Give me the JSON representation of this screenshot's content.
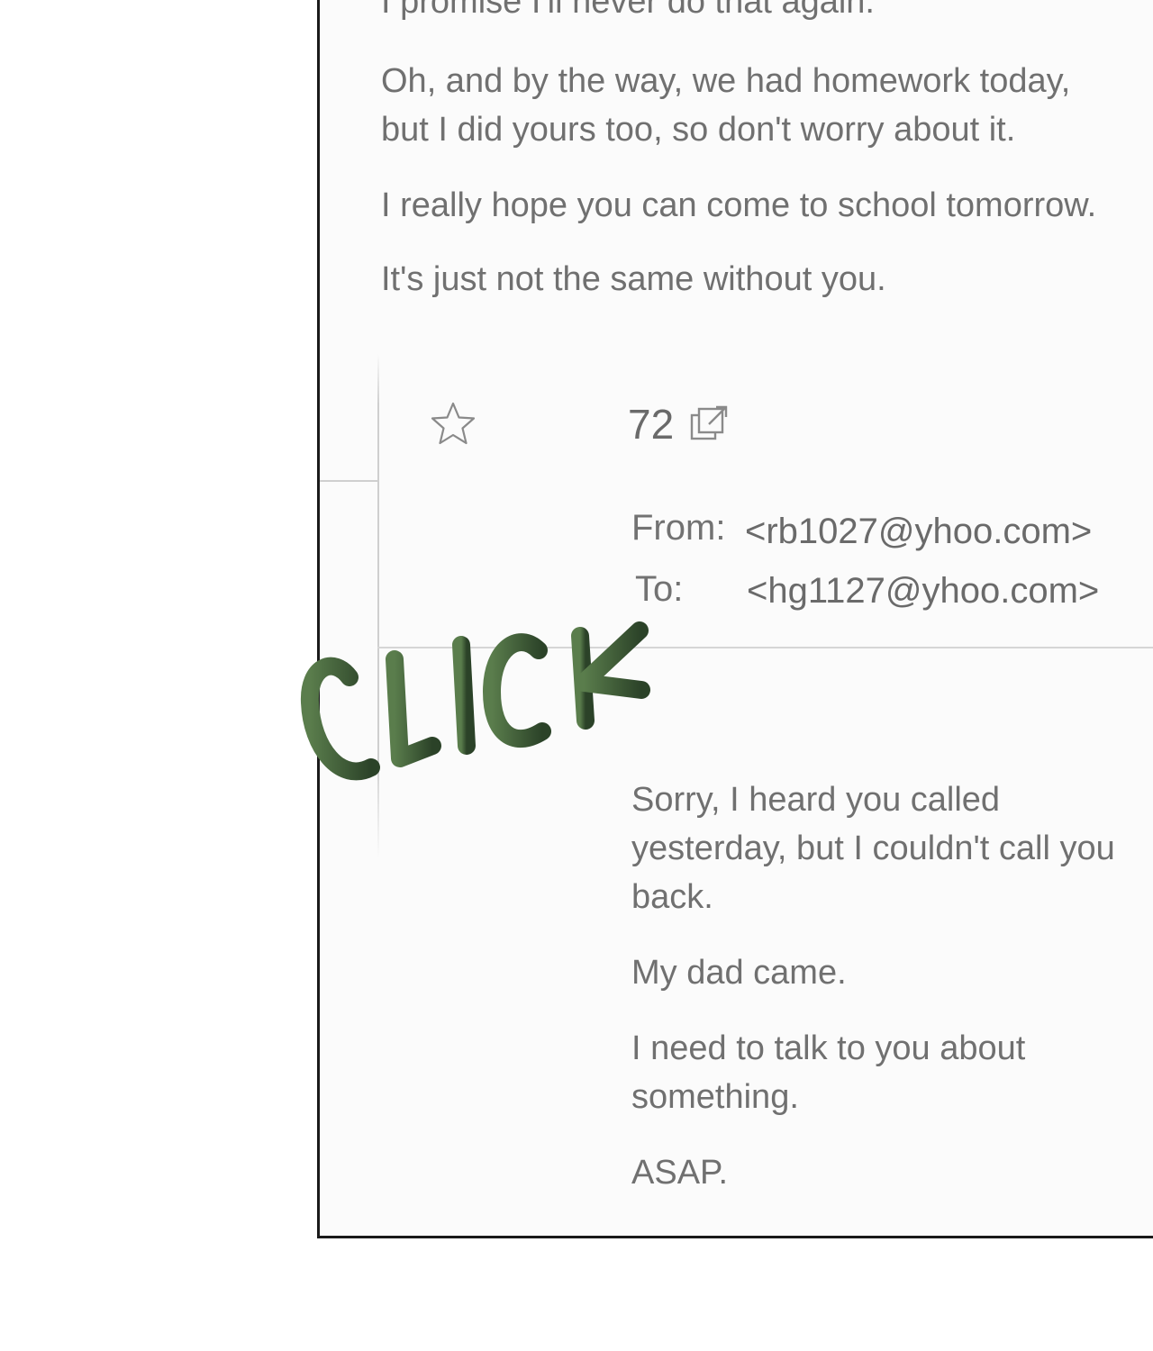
{
  "email_body": {
    "cut_line": "I promise I'll never do that again.",
    "paragraph_1": "Oh, and by the way, we had homework today, but I did yours too, so don't worry about it.",
    "paragraph_2": "I really hope you can come to school tomorrow.",
    "paragraph_3": "It's just not the same without you."
  },
  "message_header": {
    "star_icon": "star-outline-icon",
    "count": "72",
    "share_icon": "external-link-icon",
    "from_label": "From:",
    "from_value": "<rb1027@yhoo.com>",
    "to_label": "To:",
    "to_value": "<hg1127@yhoo.com>"
  },
  "reply_body": {
    "paragraph_1": "Sorry, I heard you called yesterday, but I couldn't call you back.",
    "paragraph_2": "My dad came.",
    "paragraph_3": "I need to talk to you about something.",
    "paragraph_4": "ASAP."
  },
  "sound_effect": {
    "text": "CLICK",
    "color": "#3f5f36"
  },
  "colors": {
    "panel_border": "#1a1a1a",
    "panel_background": "#fbfbfb",
    "text": "#707070",
    "divider": "#d6d6d6"
  }
}
